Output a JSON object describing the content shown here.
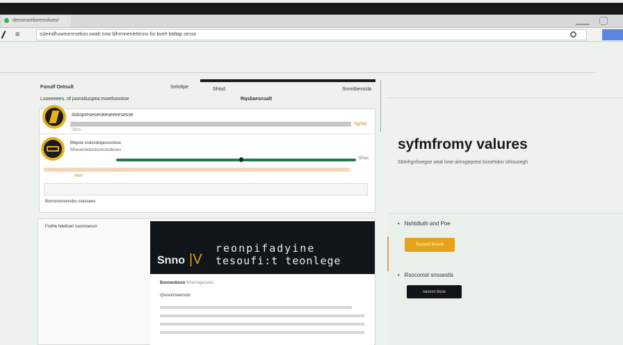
{
  "browser": {
    "tab_title": "devsmonitoresrolues/",
    "url": "ssleindhuwmenrsetion.swah.nnw blhrmnenlettmno  for bveh btdtap sesse"
  },
  "left_panel": {
    "title": "Fonulf Ontsult",
    "subtitle": "Lsoeeeees. of joonstiuspea moethoostoe",
    "col_a": "Snhdtpe",
    "col_b": "Shtsd",
    "col_c": "Snnntbesssla",
    "col_d": "Rqsliaesnsalt",
    "items": [
      {
        "title": "dsbspreseseneeseeeesesse",
        "bar_label": "Sbns",
        "value": "Sg%s"
      },
      {
        "title": "Bfepoe sndsndstpossststos",
        "sub": "Bfsesestetststostestodeseo",
        "legend": "Ablo",
        "end_label": "Slhas"
      }
    ],
    "footer": "Bsnnsnsnsensbo ssessees"
  },
  "hero_section": {
    "label": "Fodhe hdeltsen ssonnsessn",
    "brand": "Snno",
    "brand_mark": "|V",
    "line1": "reonpifadyine",
    "line2": "tesoufi:t teonlege",
    "meta_a": "Bsnneobsno",
    "meta_b": "Wnnnngesseis",
    "heading": "Qsssnnnsenssts"
  },
  "right_panel": {
    "title": "syfmfromy valures",
    "subtitle": "Sbtnfrgnhoegse oeat lone almsgeprest bsnehdon sthsuoegh",
    "step1": {
      "label": "Nshtdtuth and Poe",
      "button": "Ssssnst fossnb"
    },
    "step2": {
      "label": "Rsocomst snssestis",
      "button": "sesssn bsse"
    }
  },
  "colors": {
    "accent": "#e6a21a",
    "dark": "#101519",
    "green": "#1e7a48"
  }
}
